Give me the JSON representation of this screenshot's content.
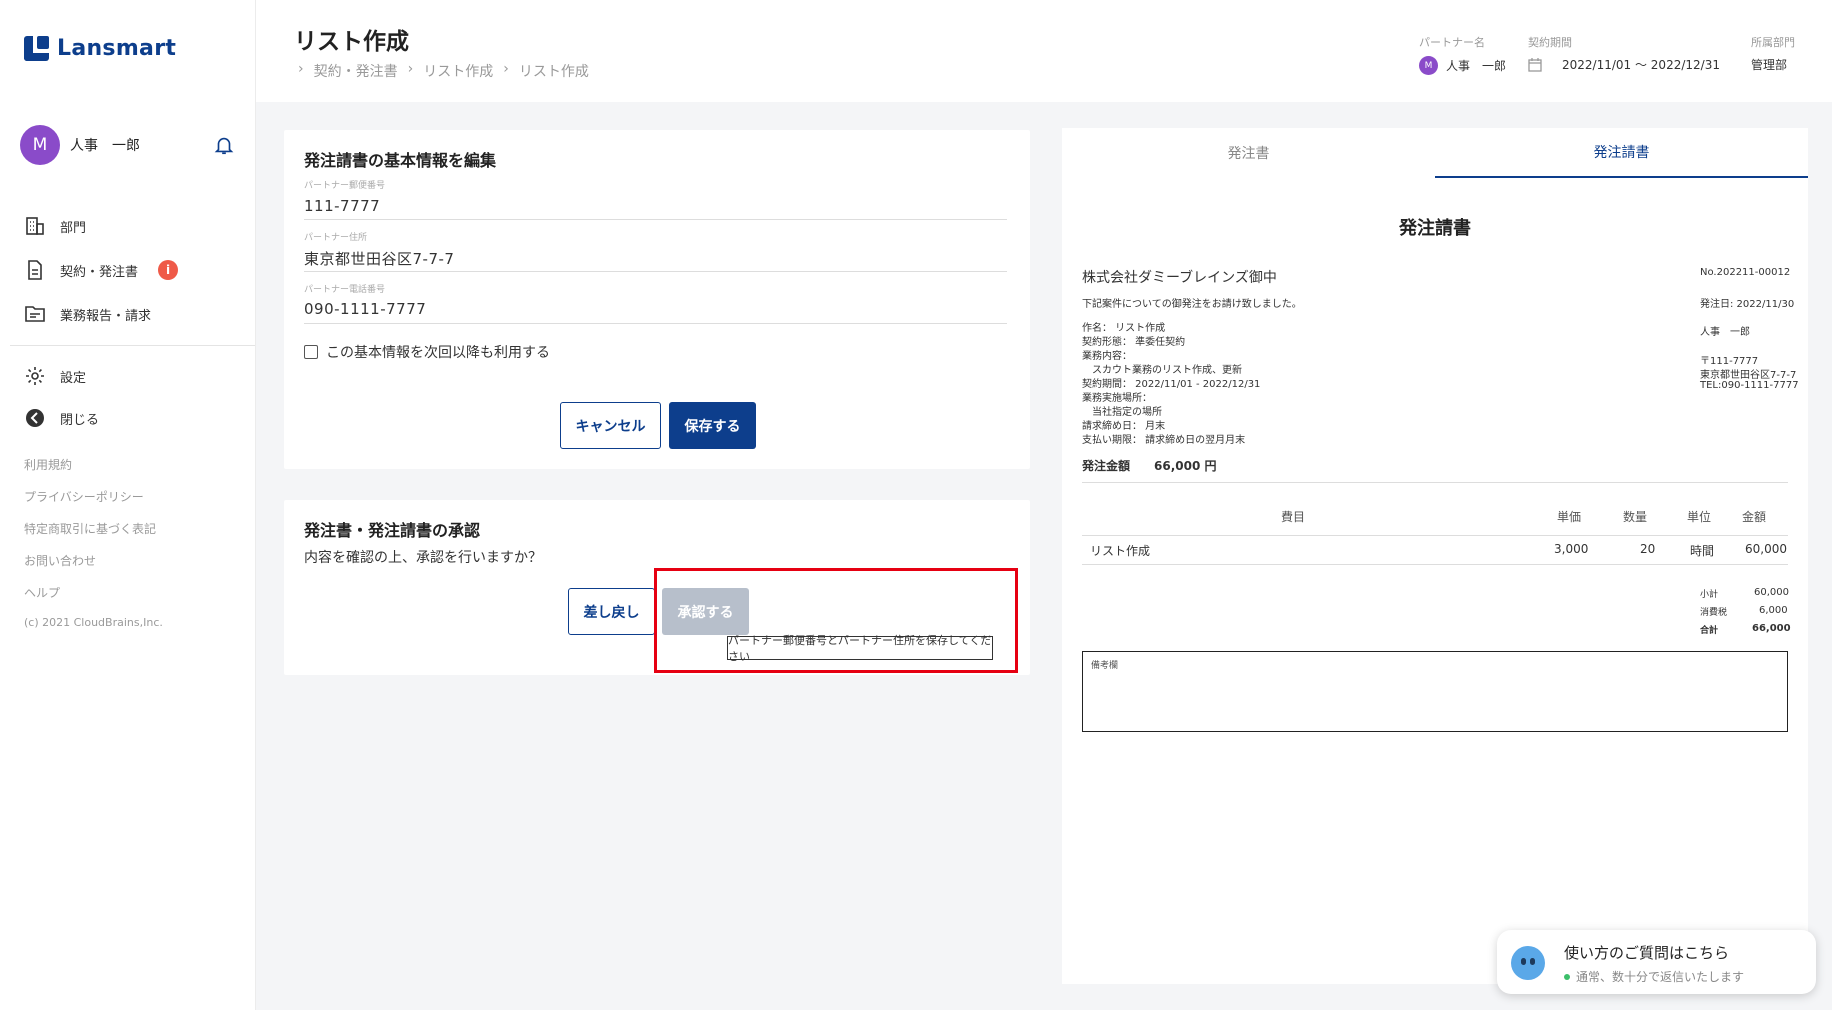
{
  "app": {
    "logo": "Lansmart"
  },
  "user": {
    "initial": "M",
    "name": "人事　一郎"
  },
  "sidebar": {
    "items": [
      {
        "label": "部門"
      },
      {
        "label": "契約・発注書",
        "badge": "i"
      },
      {
        "label": "業務報告・請求"
      },
      {
        "label": "設定"
      },
      {
        "label": "閉じる"
      }
    ],
    "footer": [
      "利用規約",
      "プライバシーポリシー",
      "特定商取引に基づく表記",
      "お問い合わせ",
      "ヘルプ",
      "(c) 2021 CloudBrains,Inc."
    ]
  },
  "header": {
    "title": "リスト作成",
    "breadcrumb": [
      "契約・発注書",
      "リスト作成",
      "リスト作成"
    ],
    "partner_label": "パートナー名",
    "partner_initial": "M",
    "partner_name": "人事　一郎",
    "period_label": "契約期間",
    "period_value": "2022/11/01 ～ 2022/12/31",
    "dept_label": "所属部門",
    "dept_value": "管理部"
  },
  "edit_card": {
    "title": "発注請書の基本情報を編集",
    "fields": [
      {
        "label": "パートナー郵便番号",
        "value": "111-7777"
      },
      {
        "label": "パートナー住所",
        "value": "東京都世田谷区7-7-7"
      },
      {
        "label": "パートナー電話番号",
        "value": "090-1111-7777"
      }
    ],
    "checkbox_label": "この基本情報を次回以降も利用する",
    "cancel_label": "キャンセル",
    "save_label": "保存する"
  },
  "approve_card": {
    "title": "発注書・発注請書の承認",
    "question": "内容を確認の上、承認を行いますか？",
    "reject_label": "差し戻し",
    "approve_label": "承認する",
    "tooltip": "パートナー郵便番号とパートナー住所を保存してください"
  },
  "doc": {
    "tabs": [
      "発注書",
      "発注請書"
    ],
    "title": "発注請書",
    "client": "株式会社ダミーブレインズ御中",
    "intro": "下記案件についての御発注をお請け致しました。",
    "lines": [
      "作名： リスト作成",
      "契約形態：  準委任契約",
      "業務内容：",
      "　スカウト業務のリスト作成、更新",
      "契約期間：  2022/11/01 - 2022/12/31",
      "業務実施場所：",
      "　当社指定の場所",
      "請求締め日：  月末",
      "支払い期限：  請求締め日の翌月月末"
    ],
    "no": "No.202211-00012",
    "issue_date": "発注日: 2022/11/30",
    "partner": "人事　一郎",
    "zip": "〒111-7777",
    "address": "東京都世田谷区7-7-7",
    "tel": "TEL:090-1111-7777",
    "amount_label": "発注金額",
    "amount_value": "66,000 円",
    "table_headers": [
      "費目",
      "単価",
      "数量",
      "単位",
      "金額"
    ],
    "row": {
      "item": "リスト作成",
      "price": "3,000",
      "qty": "20",
      "unit": "時間",
      "amount": "60,000"
    },
    "subtotal_label": "小計",
    "subtotal": "60,000",
    "tax_label": "消費税",
    "tax": "6,000",
    "total_label": "合計",
    "total": "66,000",
    "remarks_label": "備考欄"
  },
  "chat": {
    "title": "使い方のご質問はこちら",
    "status": "通常、数十分で返信いたします"
  },
  "colors": {
    "primary": "#0d3e8c",
    "avatar": "#8a4bc9",
    "alert": "#ef5a48",
    "highlight": "#e60012",
    "disabled": "#b7bfcb"
  }
}
